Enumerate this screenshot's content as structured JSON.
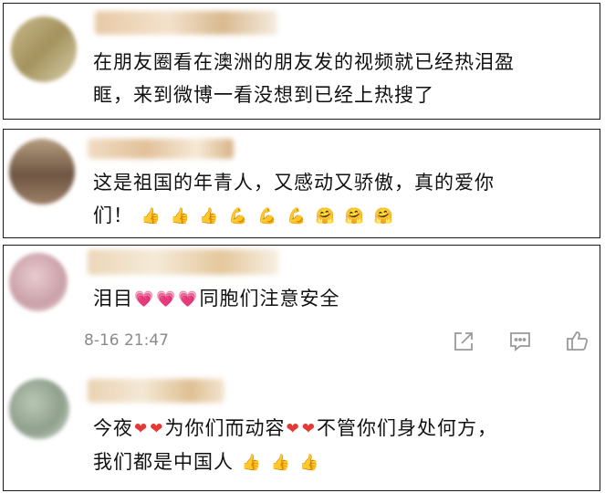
{
  "comments": [
    {
      "text_line1": "在朋友圈看在澳洲的朋友发的视频就已经热泪盈",
      "text_line2": "眶，来到微博一看没想到已经上热搜了"
    },
    {
      "text_line1": "这是祖国的年青人，又感动又骄傲，真的爱你",
      "text_line2_prefix": "们！",
      "emoji": [
        "👍",
        "👍",
        "👍",
        "💪",
        "💪",
        "💪",
        "🤗",
        "🤗",
        "🤗"
      ]
    },
    {
      "text_prefix": "泪目",
      "emoji": [
        "💗",
        "💗",
        "💗"
      ],
      "text_suffix": "同胞们注意安全",
      "time": "8-16 21:47"
    },
    {
      "text_line1_a": "今夜",
      "hearts_a": [
        "❤",
        "❤"
      ],
      "text_line1_b": "为你们而动容",
      "hearts_b": [
        "❤",
        "❤"
      ],
      "text_line1_c": "不管你们身处何方，",
      "text_line2": "我们都是中国人",
      "emoji": [
        "👍",
        "👍",
        "👍"
      ]
    }
  ],
  "icons": {
    "share": "share-icon",
    "comment": "comment-icon",
    "like": "thumbs-up-icon"
  },
  "colors": {
    "heart": "#e53935",
    "pink_heart": "#f06292",
    "meta_text": "#8a8a8a"
  }
}
